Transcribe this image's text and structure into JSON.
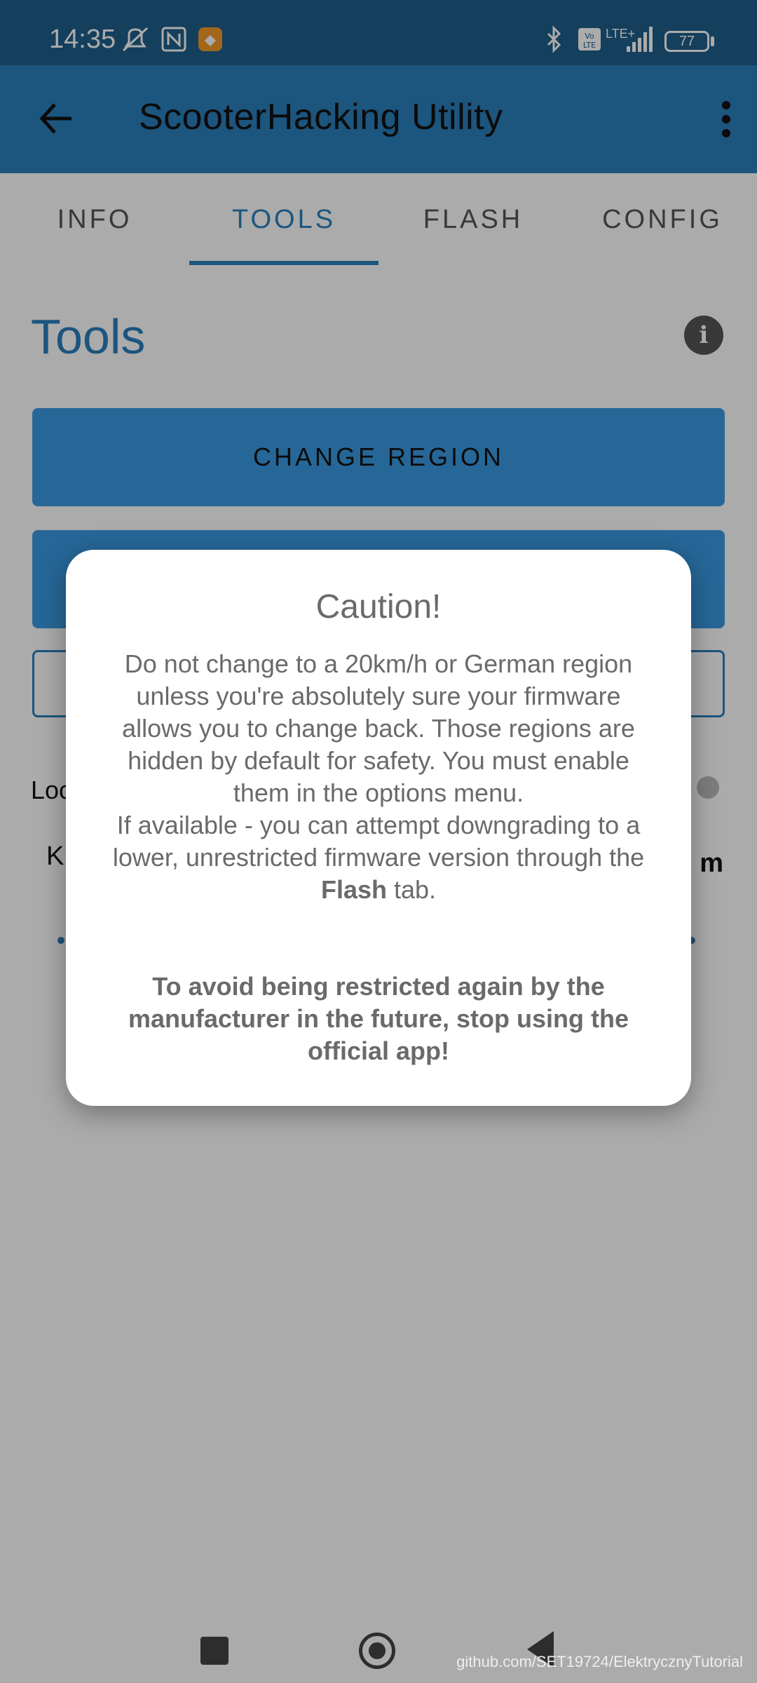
{
  "status_bar": {
    "time": "14:35",
    "battery": "77",
    "network": "LTE+"
  },
  "app_bar": {
    "title": "ScooterHacking Utility"
  },
  "tabs": [
    {
      "label": "INFO"
    },
    {
      "label": "TOOLS",
      "active": true
    },
    {
      "label": "FLASH"
    },
    {
      "label": "CONFIG"
    }
  ],
  "content": {
    "title": "Tools",
    "change_region_label": "CHANGE REGION",
    "row_label_partial": "Loc",
    "row_k_partial": "K",
    "row_m_partial": "m"
  },
  "dialog": {
    "title": "Caution!",
    "body_before_bold": "Do not change to a 20km/h or German region unless you're absolutely sure your firmware allows you to change back. Those regions are hidden by default for safety. You must enable them in the options menu.",
    "body_line2_before": "If available - you can attempt downgrading to a lower, unrestricted firmware version through the ",
    "body_bold": "Flash",
    "body_after_bold": " tab.",
    "warning": "To avoid being restricted again by the manufacturer in the future, stop using the official app!"
  },
  "watermark": "github.com/SET19724/ElektrycznyTutorial",
  "colors": {
    "primary": "#2b7fbd",
    "status_bar": "#1f5f8b",
    "button": "#3a9ae3"
  }
}
